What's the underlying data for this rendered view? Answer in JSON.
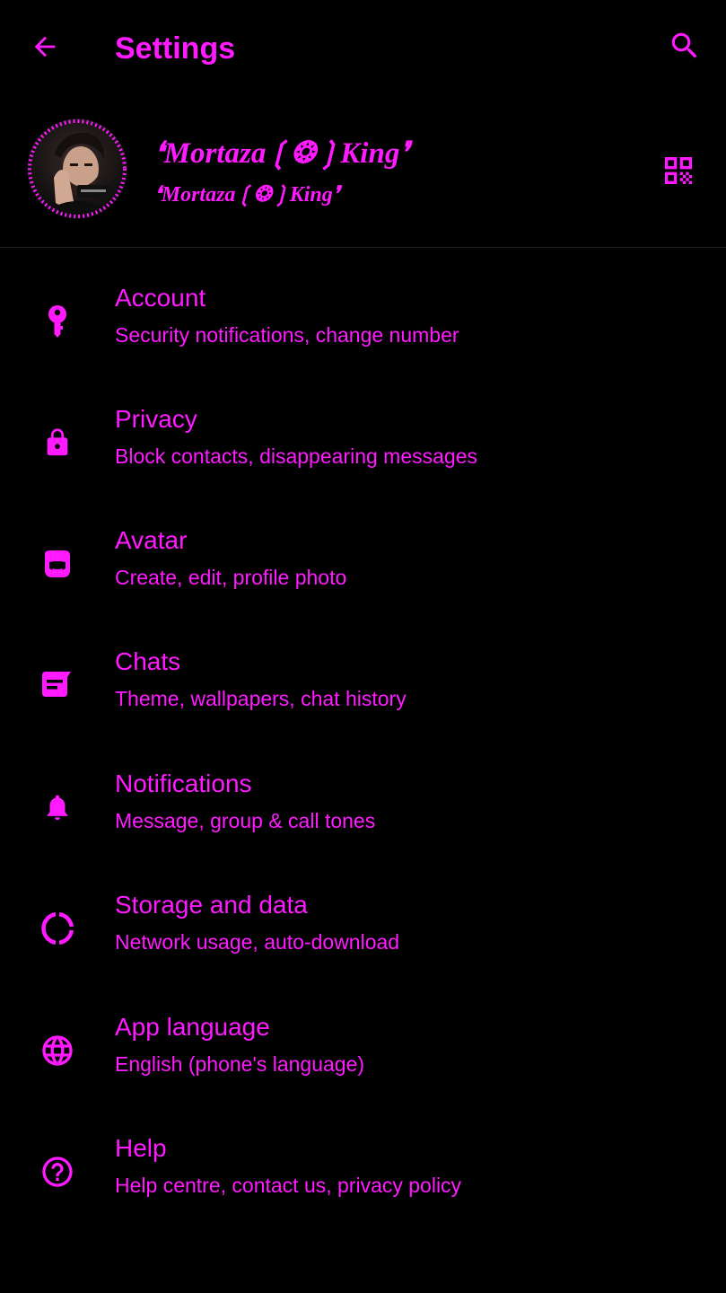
{
  "theme": {
    "accent": "#ff1aff",
    "background": "#000000",
    "divider": "#1f1f1f"
  },
  "app_bar": {
    "title": "Settings",
    "back_icon": "arrow-left-icon",
    "search_icon": "search-icon"
  },
  "profile": {
    "name": "❛Mortaza❲❂❳King❜",
    "about": "❛Mortaza❲❂❳King❜",
    "qr_icon": "qr-code-icon"
  },
  "menu": [
    {
      "label": "Account",
      "subtitle": "Security notifications, change number",
      "icon": "key-icon"
    },
    {
      "label": "Privacy",
      "subtitle": "Block contacts, disappearing messages",
      "icon": "lock-icon"
    },
    {
      "label": "Avatar",
      "subtitle": "Create, edit, profile photo",
      "icon": "avatar-icon"
    },
    {
      "label": "Chats",
      "subtitle": "Theme, wallpapers, chat history",
      "icon": "chat-icon"
    },
    {
      "label": "Notifications",
      "subtitle": "Message, group & call tones",
      "icon": "bell-icon"
    },
    {
      "label": "Storage and data",
      "subtitle": "Network usage, auto-download",
      "icon": "storage-icon"
    },
    {
      "label": "App language",
      "subtitle": "English (phone's language)",
      "icon": "globe-icon"
    },
    {
      "label": "Help",
      "subtitle": "Help centre, contact us, privacy policy",
      "icon": "help-icon"
    }
  ]
}
